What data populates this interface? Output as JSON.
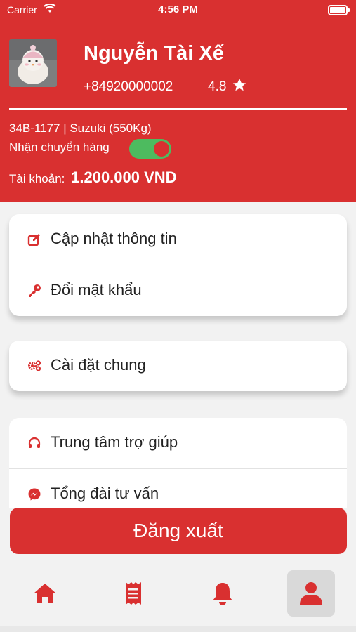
{
  "status_bar": {
    "carrier": "Carrier",
    "time": "4:56 PM"
  },
  "profile": {
    "name": "Nguyễn Tài Xế",
    "phone": "+84920000002",
    "rating": "4.8",
    "vehicle": "34B-1177 | Suzuki (550Kg)",
    "accept_label": "Nhận chuyển hàng",
    "accept_enabled": true,
    "account_label": "Tài khoản:",
    "account_amount": "1.200.000 VND"
  },
  "menu": {
    "group1": [
      {
        "label": "Cập nhật thông tin",
        "icon": "edit-icon"
      },
      {
        "label": "Đổi mật khẩu",
        "icon": "key-icon"
      }
    ],
    "group2": [
      {
        "label": "Cài đặt chung",
        "icon": "settings-icon"
      }
    ],
    "group3": [
      {
        "label": "Trung tâm trợ giúp",
        "icon": "headset-icon"
      },
      {
        "label": "Tổng đài tư vấn",
        "icon": "messenger-icon"
      }
    ]
  },
  "logout_label": "Đăng xuất",
  "tabs": [
    {
      "icon": "home-icon",
      "active": false
    },
    {
      "icon": "receipt-icon",
      "active": false
    },
    {
      "icon": "bell-icon",
      "active": false
    },
    {
      "icon": "user-icon",
      "active": true
    }
  ],
  "colors": {
    "primary": "#d93030",
    "toggle_on": "#4dbb5f",
    "background": "#f2f2f2"
  }
}
